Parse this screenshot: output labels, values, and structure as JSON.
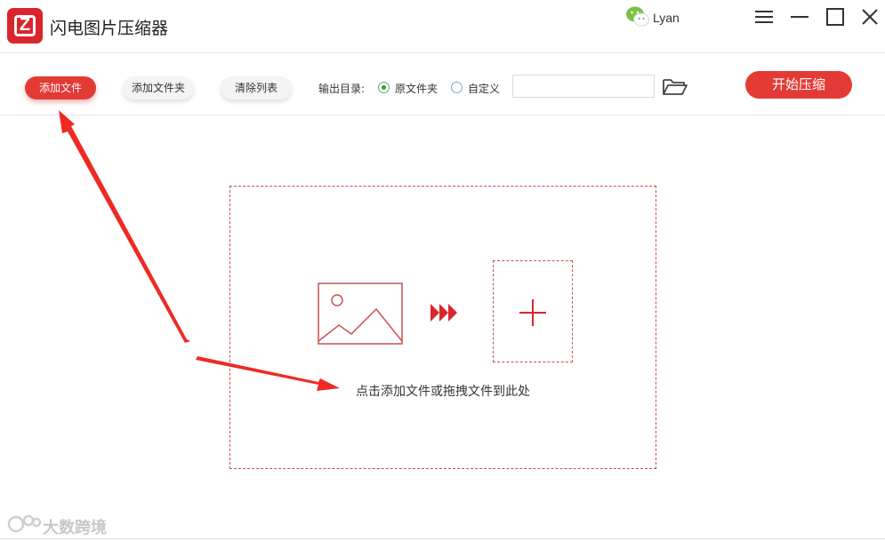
{
  "app": {
    "title": "闪电图片压缩器",
    "logo_letter": "Z",
    "brand_color": "#d9262c"
  },
  "user": {
    "name": "Lyan",
    "avatar_icon": "wechat-icon"
  },
  "window_controls": [
    "menu-icon",
    "minimize-icon",
    "maximize-icon",
    "close-icon"
  ],
  "toolbar": {
    "add_file_label": "添加文件",
    "add_folder_label": "添加文件夹",
    "clear_list_label": "清除列表",
    "output_label": "输出目录:",
    "radio_original_label": "原文件夹",
    "radio_custom_label": "自定义",
    "selected_output": "原文件夹",
    "output_path_value": "",
    "start_label": "开始压缩"
  },
  "drop_zone": {
    "hint": "点击添加文件或拖拽文件到此处"
  },
  "watermark": {
    "text": "大数跨境"
  }
}
